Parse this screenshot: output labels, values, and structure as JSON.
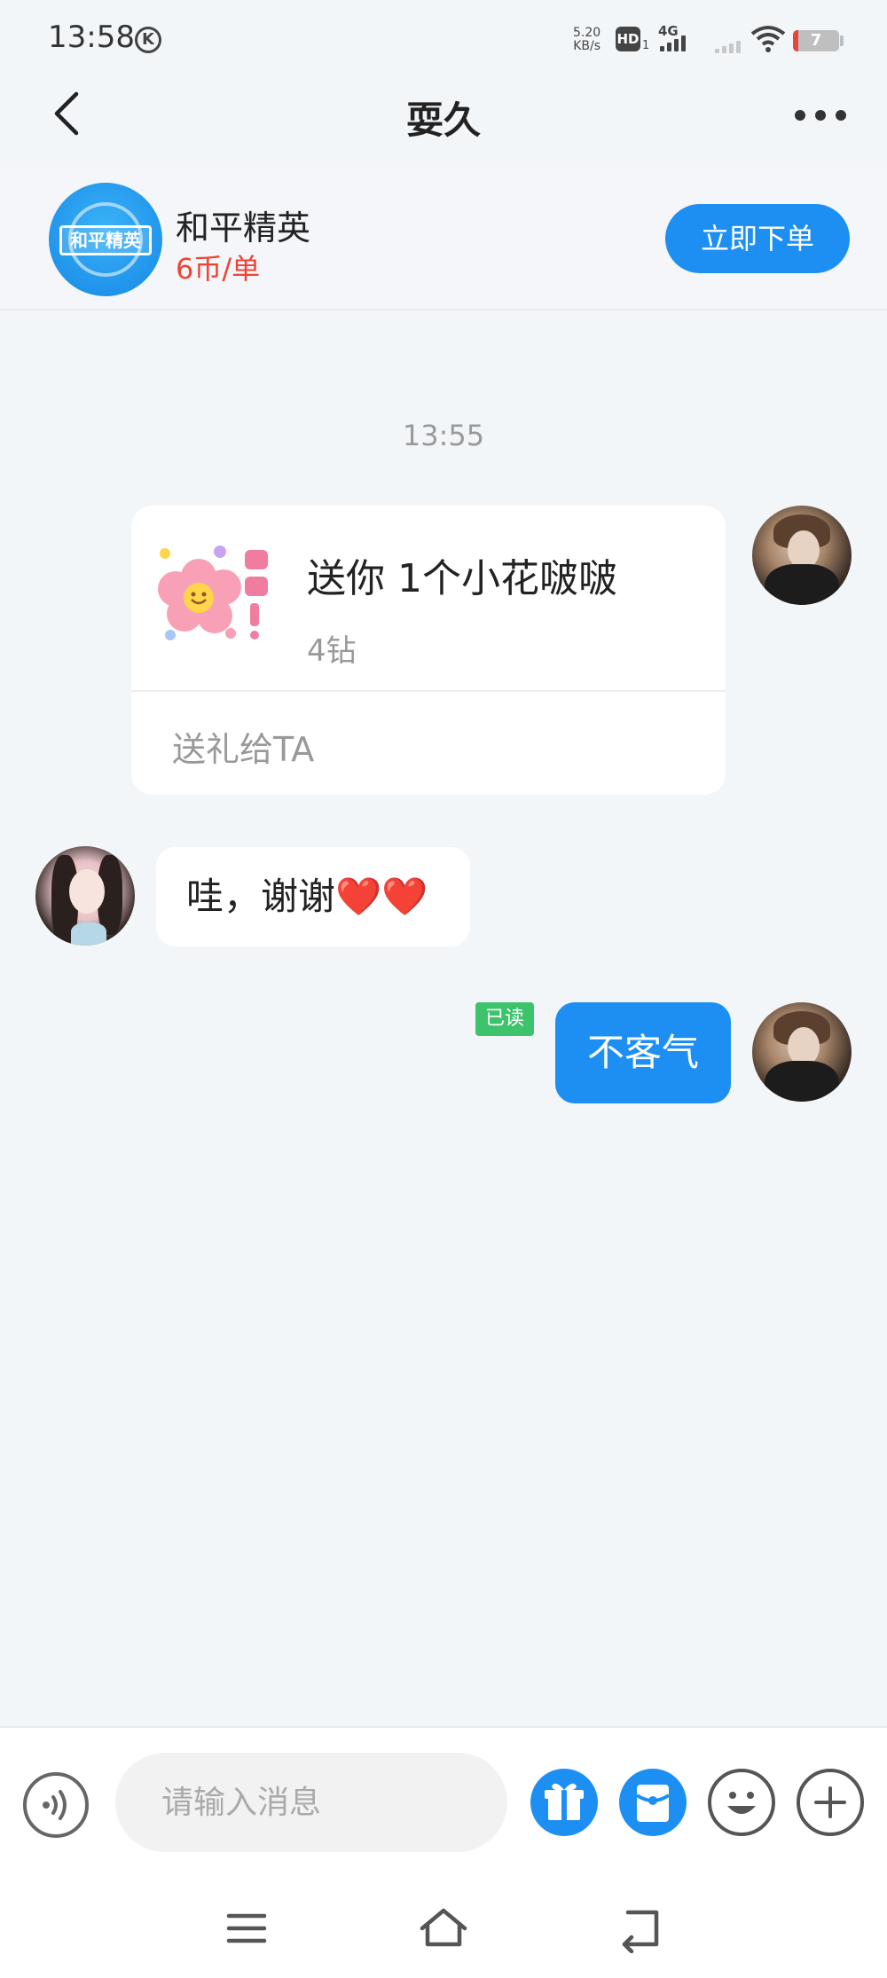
{
  "status_bar": {
    "time": "13:58",
    "status_icon": "K",
    "net_speed_value": "5.20",
    "net_speed_unit": "KB/s",
    "hd_label": "HD",
    "hd_sub": "1",
    "network_type": "4G",
    "battery_level": "7",
    "battery_fraction": 0.07
  },
  "header": {
    "title": "耍久"
  },
  "game_card": {
    "logo_text": "和平精英",
    "name": "和平精英",
    "price": "6币/单",
    "order_button": "立即下单"
  },
  "chat": {
    "timestamp": "13:55",
    "gift_message": {
      "title": "送你 1个小花啵啵",
      "price": "4钻",
      "action": "送礼给TA"
    },
    "received_message": "哇，谢谢❤️❤️",
    "read_label": "已读",
    "sent_message": "不客气"
  },
  "input_bar": {
    "placeholder": "请输入消息"
  },
  "colors": {
    "accent": "#1e8ff2",
    "price_red": "#ef4336",
    "read_green": "#3cc36b",
    "background": "#f3f6f9"
  }
}
